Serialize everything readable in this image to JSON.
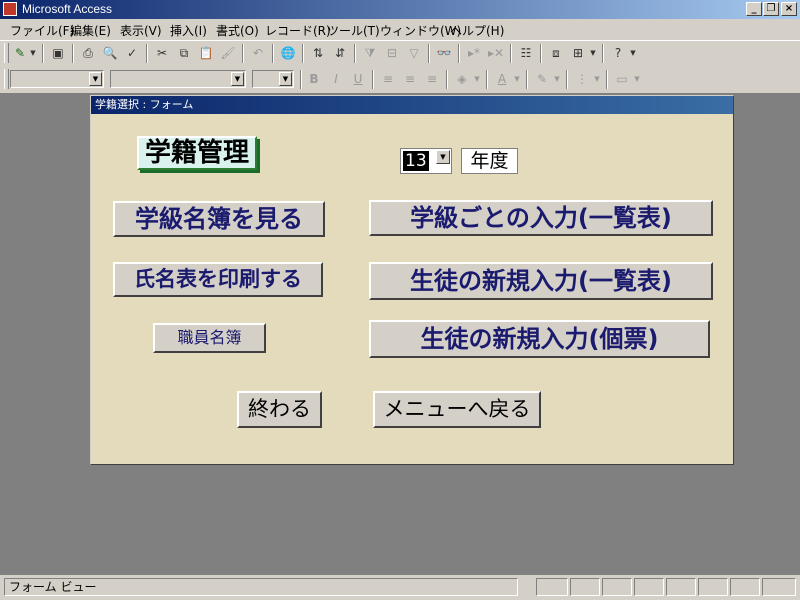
{
  "window": {
    "title": "Microsoft Access"
  },
  "menu": [
    "ファイル(F)",
    "編集(E)",
    "表示(V)",
    "挿入(I)",
    "書式(O)",
    "レコード(R)",
    "ツール(T)",
    "ウィンドウ(W)",
    "ヘルプ(H)"
  ],
  "form": {
    "title": "学籍選択 : フォーム",
    "heading": "学籍管理",
    "year_value": "13",
    "year_label": "年度",
    "buttons": {
      "class_list": "学級名簿を見る",
      "class_input": "学級ごとの入力(一覧表)",
      "print_names": "氏名表を印刷する",
      "new_student_list": "生徒の新規入力(一覧表)",
      "staff_list": "職員名簿",
      "new_student_card": "生徒の新規入力(個票)",
      "quit": "終わる",
      "back_to_menu": "メニューへ戻る"
    }
  },
  "statusbar": {
    "text": "フォーム ビュー"
  },
  "colors": {
    "titlebar": "#0a246a",
    "form_bg": "#e3dbbb",
    "button_text": "#1a1a6e",
    "heading_bg": "#d9f2ee",
    "workspace": "#808080"
  }
}
